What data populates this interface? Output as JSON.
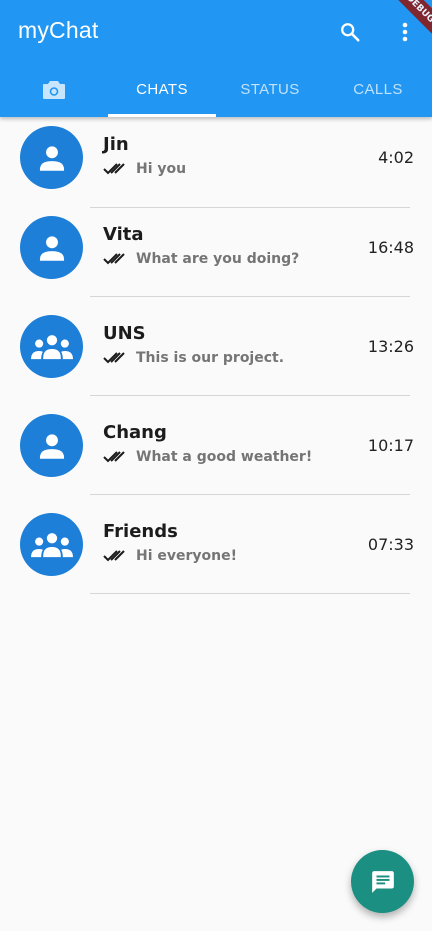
{
  "app": {
    "title": "myChat",
    "debug_banner": "DEBUG",
    "colors": {
      "primary": "#2196f3",
      "avatar": "#1e7fd8",
      "fab": "#1a8f82"
    }
  },
  "toolbar": {
    "search_icon": "search-icon",
    "more_icon": "more-vert-icon"
  },
  "tabs": [
    {
      "label": "",
      "icon": "camera-icon",
      "selected": false
    },
    {
      "label": "CHATS",
      "selected": true
    },
    {
      "label": "STATUS",
      "selected": false
    },
    {
      "label": "CALLS",
      "selected": false
    }
  ],
  "chats": [
    {
      "name": "Jin",
      "message": "Hi you",
      "time": "4:02",
      "avatar_icon": "person-icon",
      "status_icon": "double-check-icon"
    },
    {
      "name": "Vita",
      "message": "What are you doing?",
      "time": "16:48",
      "avatar_icon": "person-icon",
      "status_icon": "double-check-icon"
    },
    {
      "name": "UNS",
      "message": "This is our project.",
      "time": "13:26",
      "avatar_icon": "group-icon",
      "status_icon": "double-check-icon"
    },
    {
      "name": "Chang",
      "message": "What a good weather!",
      "time": "10:17",
      "avatar_icon": "person-icon",
      "status_icon": "double-check-icon"
    },
    {
      "name": "Friends",
      "message": "Hi everyone!",
      "time": "07:33",
      "avatar_icon": "group-icon",
      "status_icon": "double-check-icon"
    }
  ],
  "fab": {
    "icon": "message-icon"
  }
}
